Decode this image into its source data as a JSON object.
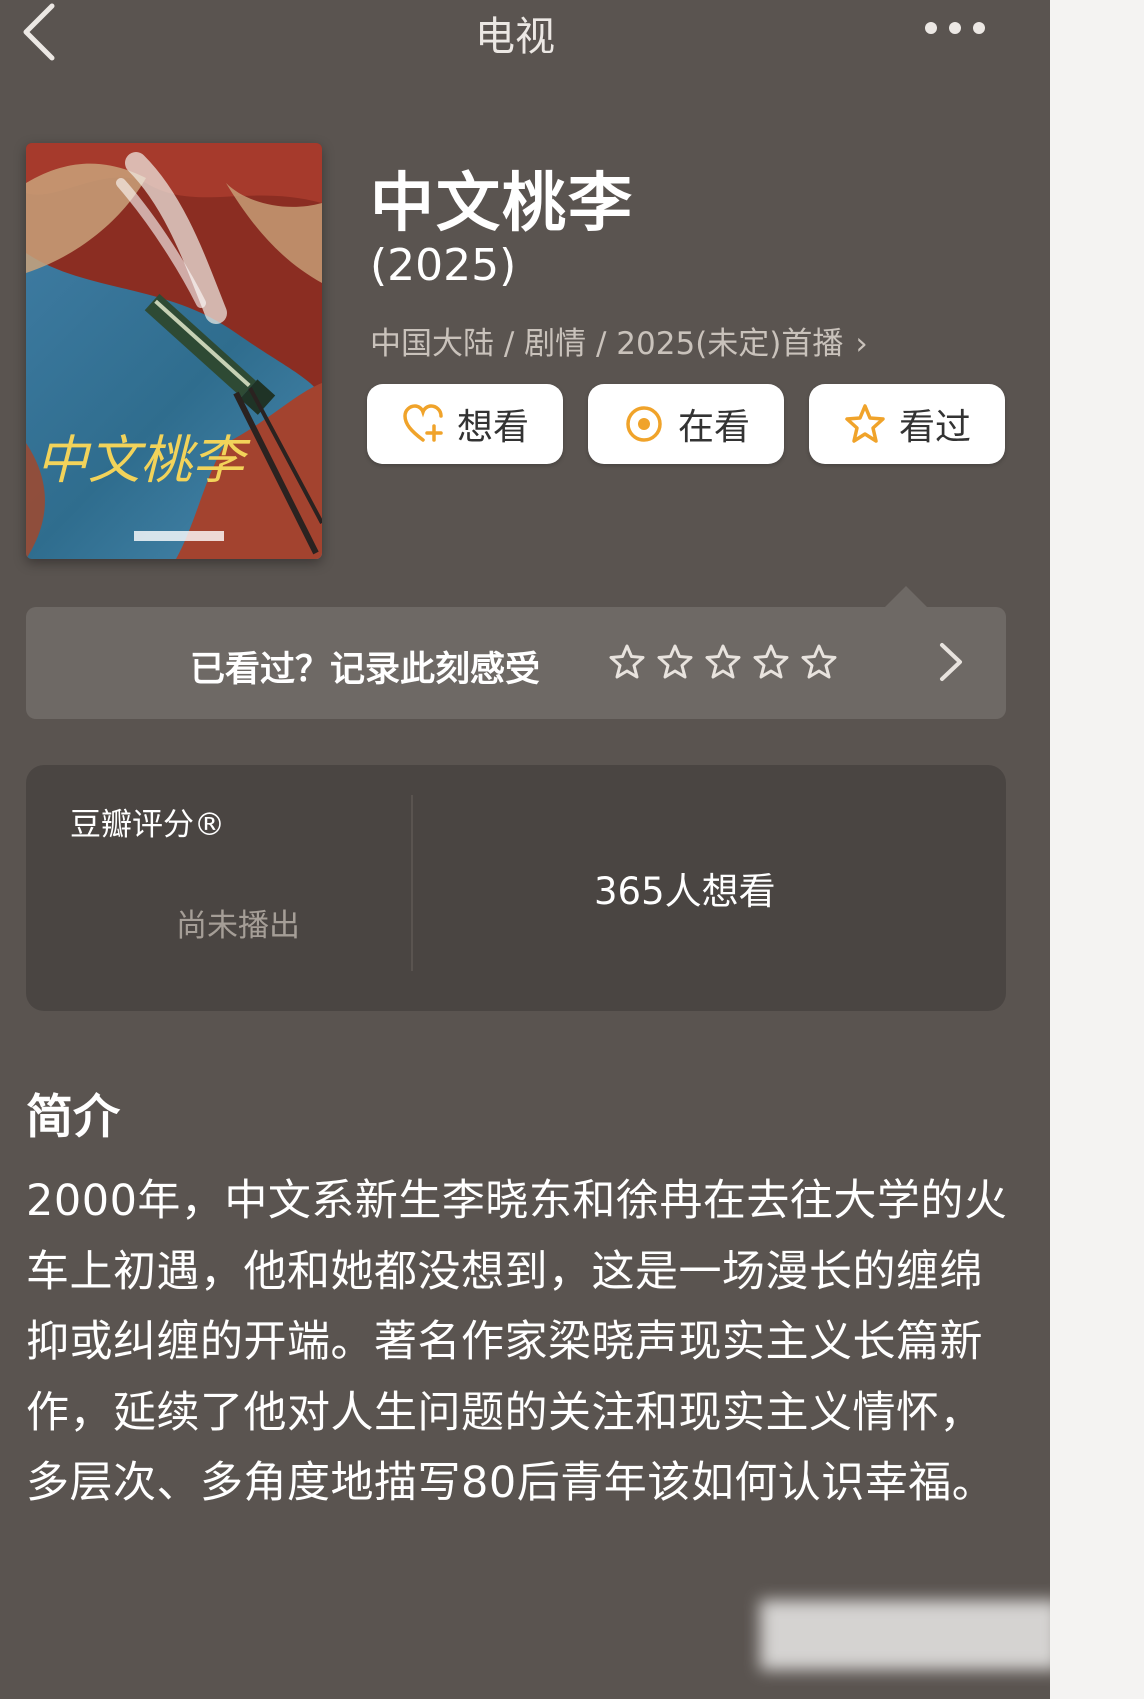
{
  "header": {
    "title": "电视",
    "back_icon": "chevron-left-icon",
    "more_icon": "more-dots-icon"
  },
  "show": {
    "title": "中文桃李",
    "year": "(2025)",
    "meta": "中国大陆 / 剧情 / 2025(未定)首播",
    "poster_title": "中文桃李"
  },
  "actions": {
    "want_label": "想看",
    "watching_label": "在看",
    "watched_label": "看过",
    "accent_color": "#f0a32a"
  },
  "record": {
    "prompt": "已看过？记录此刻感受",
    "star_count": 5
  },
  "rating": {
    "label": "豆瓣评分®",
    "status": "尚未播出",
    "wish_count": "365人想看"
  },
  "intro": {
    "title": "简介",
    "text": "2000年，中文系新生李晓东和徐冉在去往大学的火车上初遇，他和她都没想到，这是一场漫长的缠绵抑或纠缠的开端。著名作家梁晓声现实主义长篇新作，延续了他对人生问题的关注和现实主义情怀，多层次、多角度地描写80后青年该如何认识幸福。"
  }
}
